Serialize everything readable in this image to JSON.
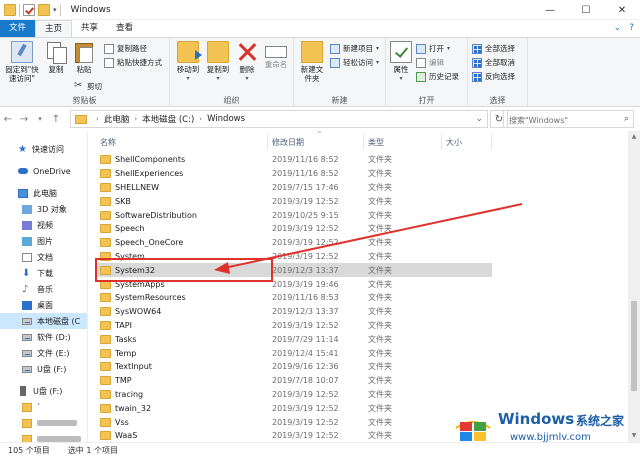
{
  "window": {
    "title": "Windows",
    "controls": {
      "minimize": "—",
      "maximize": "☐",
      "close": "✕"
    }
  },
  "ribbon_tabs": [
    {
      "label": "文件"
    },
    {
      "label": "主页"
    },
    {
      "label": "共享"
    },
    {
      "label": "查看"
    }
  ],
  "ribbon_right": {
    "collapse": "⌄",
    "help": "?"
  },
  "ribbon": {
    "clipboard": {
      "group_label": "剪贴板",
      "pin_label": "固定到\"快速访问\"",
      "copy_label": "复制",
      "paste_label": "粘贴",
      "copy_path": "复制路径",
      "paste_shortcut": "粘贴快捷方式",
      "cut": "剪切"
    },
    "organize": {
      "group_label": "组织",
      "move_to": "移动到",
      "copy_to": "复制到",
      "delete": "删除",
      "rename": "重命名"
    },
    "new": {
      "group_label": "新建",
      "new_folder": "新建文件夹",
      "new_item": "新建项目",
      "easy_access": "轻松访问"
    },
    "open": {
      "group_label": "打开",
      "properties": "属性",
      "open": "打开",
      "edit": "编辑",
      "history": "历史记录"
    },
    "select": {
      "group_label": "选择",
      "select_all": "全部选择",
      "select_none": "全部取消",
      "invert": "反向选择"
    }
  },
  "address": {
    "crumbs": [
      "此电脑",
      "本地磁盘 (C:)",
      "Windows"
    ],
    "search_placeholder": "搜索\"Windows\""
  },
  "sidebar": {
    "items": [
      {
        "label": "快速访问",
        "icon": "star-icon"
      },
      {
        "label": "OneDrive",
        "icon": "cloud-icon"
      },
      {
        "label": "此电脑",
        "icon": "computer-icon"
      },
      {
        "label": "3D 对象",
        "icon": "3d-objects-icon"
      },
      {
        "label": "视频",
        "icon": "video-icon"
      },
      {
        "label": "图片",
        "icon": "pictures-icon"
      },
      {
        "label": "文档",
        "icon": "document-icon"
      },
      {
        "label": "下载",
        "icon": "download-icon"
      },
      {
        "label": "音乐",
        "icon": "music-icon"
      },
      {
        "label": "桌面",
        "icon": "desktop-icon"
      },
      {
        "label": "本地磁盘 (C",
        "icon": "drive-icon"
      },
      {
        "label": "软件 (D:)",
        "icon": "drive-icon"
      },
      {
        "label": "文件 (E:)",
        "icon": "drive-icon"
      },
      {
        "label": "U盘 (F:)",
        "icon": "drive-icon"
      },
      {
        "label": "U盘 (F:)",
        "icon": "usb-icon"
      },
      {
        "label": "`",
        "icon": "folder-icon"
      }
    ]
  },
  "columns": {
    "name": "名称",
    "date": "修改日期",
    "type": "类型",
    "size": "大小"
  },
  "files": [
    {
      "name": "ShellComponents",
      "date": "2019/11/16 8:52",
      "type": "文件夹"
    },
    {
      "name": "ShellExperiences",
      "date": "2019/11/16 8:52",
      "type": "文件夹"
    },
    {
      "name": "SHELLNEW",
      "date": "2019/7/15 17:46",
      "type": "文件夹"
    },
    {
      "name": "SKB",
      "date": "2019/3/19 12:52",
      "type": "文件夹"
    },
    {
      "name": "SoftwareDistribution",
      "date": "2019/10/25 9:15",
      "type": "文件夹"
    },
    {
      "name": "Speech",
      "date": "2019/3/19 12:52",
      "type": "文件夹"
    },
    {
      "name": "Speech_OneCore",
      "date": "2019/3/19 12:52",
      "type": "文件夹"
    },
    {
      "name": "System",
      "date": "2019/3/19 12:52",
      "type": "文件夹"
    },
    {
      "name": "System32",
      "date": "2019/12/3 13:37",
      "type": "文件夹"
    },
    {
      "name": "SystemApps",
      "date": "2019/3/19 19:46",
      "type": "文件夹"
    },
    {
      "name": "SystemResources",
      "date": "2019/11/16 8:53",
      "type": "文件夹"
    },
    {
      "name": "SysWOW64",
      "date": "2019/12/3 13:37",
      "type": "文件夹"
    },
    {
      "name": "TAPI",
      "date": "2019/3/19 12:52",
      "type": "文件夹"
    },
    {
      "name": "Tasks",
      "date": "2019/7/29 11:14",
      "type": "文件夹"
    },
    {
      "name": "Temp",
      "date": "2019/12/4 15:41",
      "type": "文件夹"
    },
    {
      "name": "TextInput",
      "date": "2019/9/16 12:36",
      "type": "文件夹"
    },
    {
      "name": "TMP",
      "date": "2019/7/18 10:07",
      "type": "文件夹"
    },
    {
      "name": "tracing",
      "date": "2019/3/19 12:52",
      "type": "文件夹"
    },
    {
      "name": "twain_32",
      "date": "2019/3/19 12:52",
      "type": "文件夹"
    },
    {
      "name": "Vss",
      "date": "2019/3/19 12:52",
      "type": "文件夹"
    },
    {
      "name": "WaaS",
      "date": "2019/3/19 12:52",
      "type": "文件夹"
    }
  ],
  "selected_index": 8,
  "status": {
    "count": "105 个项目",
    "selected": "选中 1 个项目"
  },
  "watermark": {
    "title": "Windows",
    "cn": "系统之家",
    "url": "www.bjjmlv.com"
  },
  "colors": {
    "accent": "#1979ca",
    "annotation": "#e0322c",
    "folder": "#f3c353"
  }
}
